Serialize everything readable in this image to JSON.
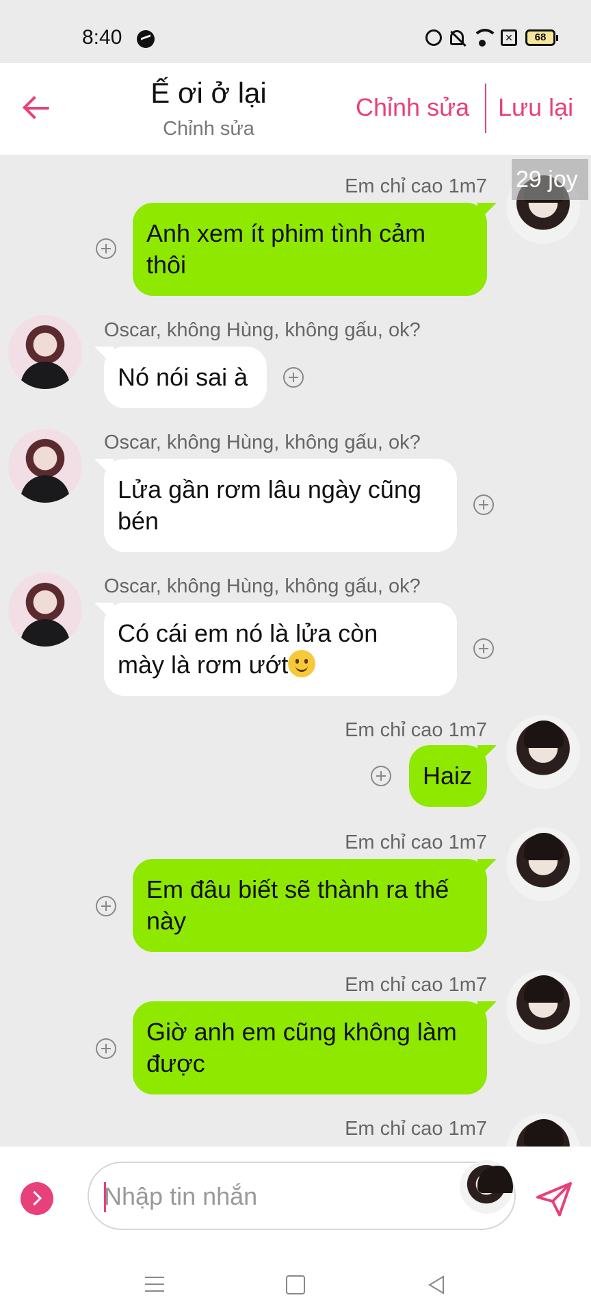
{
  "status_bar": {
    "time": "8:40",
    "battery": "68",
    "sim_mark": "✕"
  },
  "header": {
    "title": "Ế ơi ở lại",
    "subtitle": "Chỉnh sửa",
    "edit_label": "Chỉnh sửa",
    "save_label": "Lưu lại"
  },
  "badge": "29 joy",
  "messages": [
    {
      "side": "right",
      "sender": "Em chỉ cao 1m7",
      "text": "Anh xem ít phim tình cảm\nthôi"
    },
    {
      "side": "left",
      "sender": "Oscar, không Hùng, không gấu, ok?",
      "text": "Nó nói sai à"
    },
    {
      "side": "left",
      "sender": "Oscar, không Hùng, không gấu, ok?",
      "text": "Lửa gần rơm lâu ngày cũng\nbén"
    },
    {
      "side": "left",
      "sender": "Oscar, không Hùng, không gấu, ok?",
      "text": "Có cái em nó là lửa còn\nmày là rơm ướt",
      "emoji": "slightly-smiling-face"
    },
    {
      "side": "right",
      "sender": "Em chỉ cao 1m7",
      "text": "Haiz"
    },
    {
      "side": "right",
      "sender": "Em chỉ cao 1m7",
      "text": "Em đâu biết sẽ thành ra thế\nnày"
    },
    {
      "side": "right",
      "sender": "Em chỉ cao 1m7",
      "text": "Giờ anh em cũng không làm\nđược"
    },
    {
      "side": "right",
      "sender": "Em chỉ cao 1m7",
      "text": ""
    }
  ],
  "composer": {
    "placeholder": "Nhập tin nhắn"
  },
  "colors": {
    "accent": "#e8407a",
    "my_bubble": "#8fe800",
    "their_bubble": "#ffffff",
    "background": "#ebebeb"
  }
}
